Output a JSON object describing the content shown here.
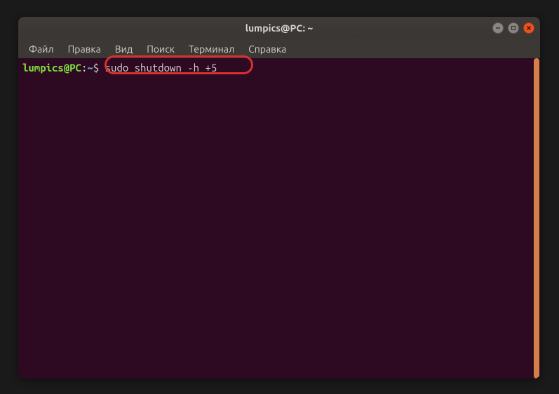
{
  "window": {
    "title": "lumpics@PC: ~"
  },
  "menubar": {
    "items": [
      {
        "label": "Файл"
      },
      {
        "label": "Правка"
      },
      {
        "label": "Вид"
      },
      {
        "label": "Поиск"
      },
      {
        "label": "Терминал"
      },
      {
        "label": "Справка"
      }
    ]
  },
  "terminal": {
    "prompt_user": "lumpics@PC",
    "prompt_sep": ":",
    "prompt_path": "~",
    "prompt_dollar": "$ ",
    "command": "sudo shutdown -h +5"
  }
}
